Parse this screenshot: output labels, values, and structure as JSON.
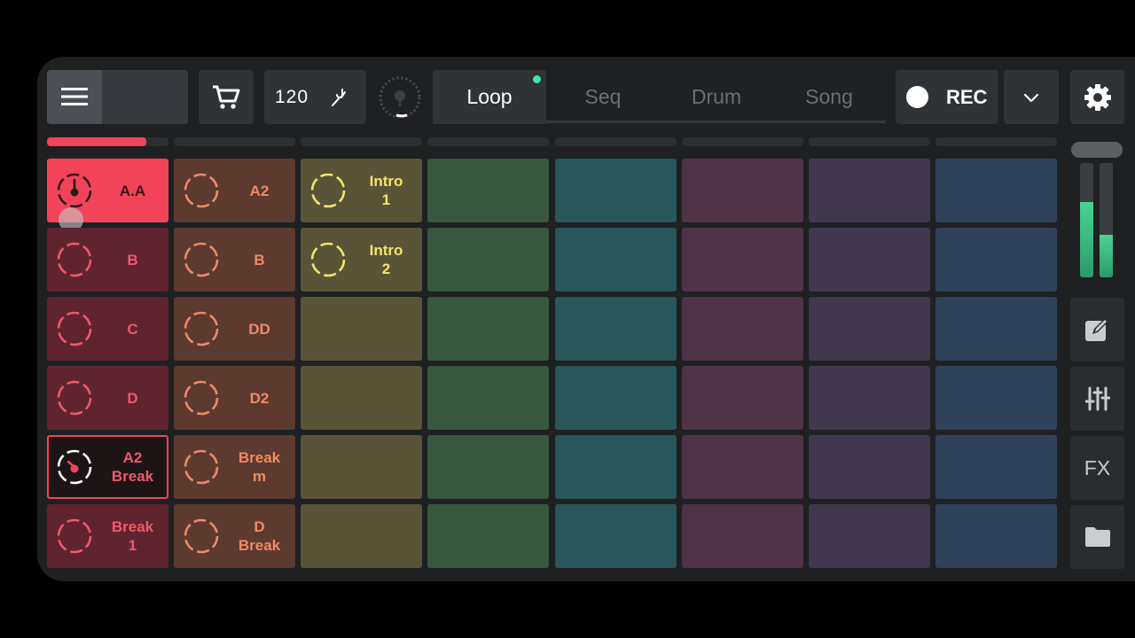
{
  "toolbar": {
    "tempo": "120",
    "tabs": [
      {
        "label": "Loop",
        "active": true,
        "has_indicator": true
      },
      {
        "label": "Seq",
        "active": false
      },
      {
        "label": "Drum",
        "active": false
      },
      {
        "label": "Song",
        "active": false
      }
    ],
    "rec_label": "REC"
  },
  "icons": {
    "menu": "hamburger-menu-icon",
    "shop": "shopping-cart-icon",
    "tap_tempo": "tuning-fork-icon",
    "metronome": "metronome-dial-icon",
    "record": "record-circle-icon",
    "dropdown": "chevron-down-icon",
    "settings": "gear-icon",
    "edit": "edit-icon",
    "mixer": "sliders-icon",
    "folder": "folder-icon"
  },
  "side": {
    "fx_label": "FX"
  },
  "meters": {
    "left_level": 0.66,
    "right_level": 0.37
  },
  "column_progress": [
    0.82,
    0,
    0,
    0,
    0,
    0,
    0,
    0
  ],
  "columns": [
    {
      "color": "#5f2430",
      "text_color": "#f1576a",
      "ring": "#f1576a",
      "pads": [
        {
          "label": "A.A",
          "state": "playing"
        },
        {
          "label": "B"
        },
        {
          "label": "C"
        },
        {
          "label": "D"
        },
        {
          "label": "A2\nBreak",
          "state": "queued"
        },
        {
          "label": "Break\n1"
        }
      ]
    },
    {
      "color": "#5c3a30",
      "text_color": "#f08a64",
      "ring": "#f08a64",
      "pads": [
        {
          "label": "A2"
        },
        {
          "label": "B"
        },
        {
          "label": "DD"
        },
        {
          "label": "D2"
        },
        {
          "label": "Break\nm"
        },
        {
          "label": "D\nBreak"
        }
      ]
    },
    {
      "color": "#595437",
      "text_color": "#f5e46a",
      "ring": "#f5e46a",
      "pads": [
        {
          "label": "Intro\n1"
        },
        {
          "label": "Intro\n2"
        },
        {
          "label": ""
        },
        {
          "label": ""
        },
        {
          "label": ""
        },
        {
          "label": ""
        }
      ]
    },
    {
      "color": "#37573f",
      "pads": [
        {
          "label": ""
        },
        {
          "label": ""
        },
        {
          "label": ""
        },
        {
          "label": ""
        },
        {
          "label": ""
        },
        {
          "label": ""
        }
      ]
    },
    {
      "color": "#295659",
      "pads": [
        {
          "label": ""
        },
        {
          "label": ""
        },
        {
          "label": ""
        },
        {
          "label": ""
        },
        {
          "label": ""
        },
        {
          "label": ""
        }
      ]
    },
    {
      "color": "#4f3346",
      "pads": [
        {
          "label": ""
        },
        {
          "label": ""
        },
        {
          "label": ""
        },
        {
          "label": ""
        },
        {
          "label": ""
        },
        {
          "label": ""
        }
      ]
    },
    {
      "color": "#41384e",
      "pads": [
        {
          "label": ""
        },
        {
          "label": ""
        },
        {
          "label": ""
        },
        {
          "label": ""
        },
        {
          "label": ""
        },
        {
          "label": ""
        }
      ]
    },
    {
      "color": "#30415a",
      "pads": [
        {
          "label": ""
        },
        {
          "label": ""
        },
        {
          "label": ""
        },
        {
          "label": ""
        },
        {
          "label": ""
        },
        {
          "label": ""
        }
      ]
    }
  ],
  "colors": {
    "playing_pad": "#f24359",
    "progress_active": "#f2435a",
    "accent_green": "#45e3a3"
  }
}
